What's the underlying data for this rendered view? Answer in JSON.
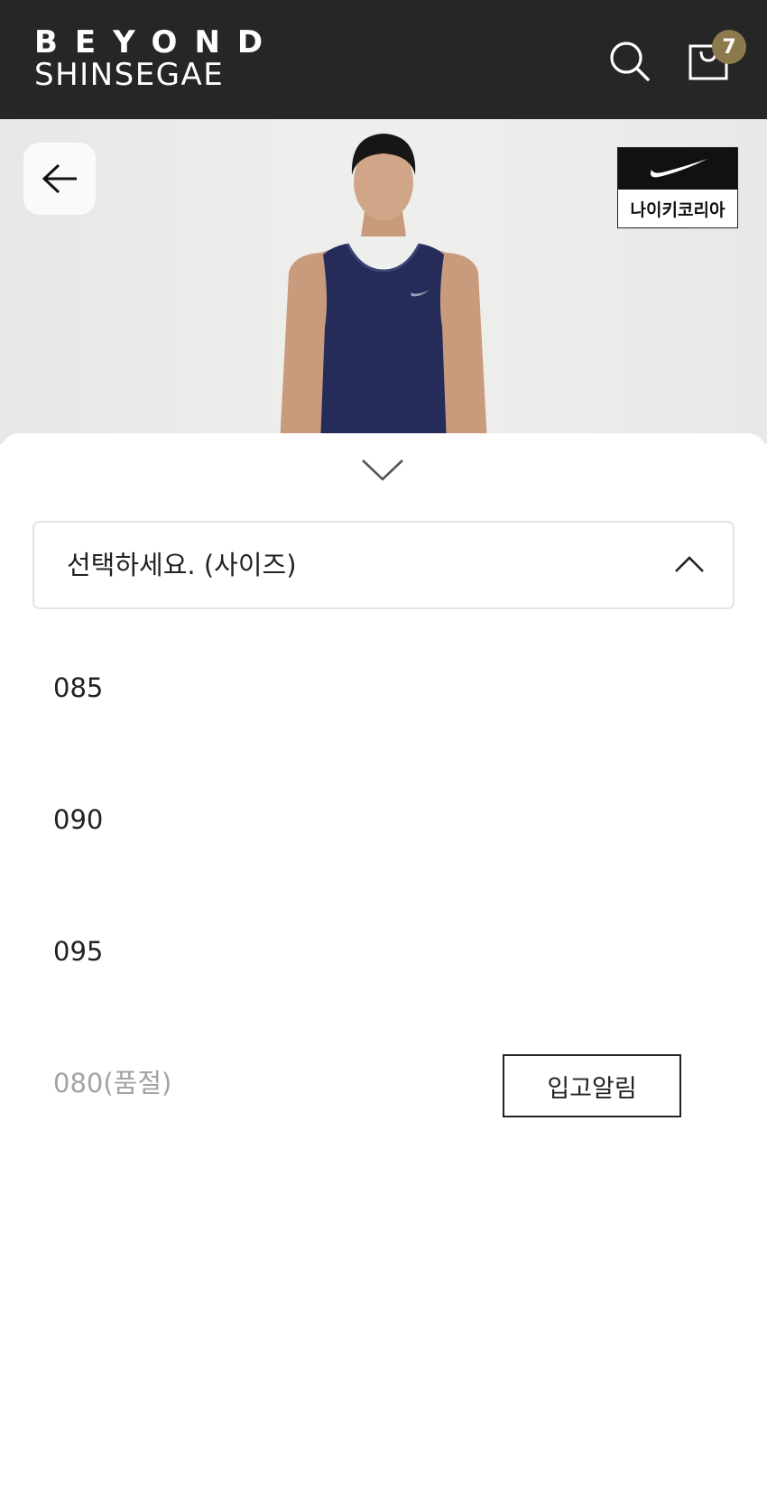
{
  "header": {
    "logo_top": "BEYOND",
    "logo_bottom": "SHINSEGAE",
    "search_icon": "search-icon",
    "cart_icon": "shopping-bag-icon",
    "cart_count": "7",
    "background": "#262626",
    "badge_color": "#8d7a4c"
  },
  "hero": {
    "back_icon": "arrow-left-icon",
    "brand_logo": "nike-swoosh-icon",
    "brand_label": "나이키코리아"
  },
  "sheet": {
    "collapse_icon": "chevron-down-icon",
    "select": {
      "label": "선택하세요. (사이즈)",
      "icon": "chevron-up-icon"
    },
    "options": [
      {
        "label": "085",
        "sold_out": false
      },
      {
        "label": "090",
        "sold_out": false
      },
      {
        "label": "095",
        "sold_out": false
      },
      {
        "label": "080(품절)",
        "sold_out": true
      }
    ],
    "restock_label": "입고알림"
  }
}
